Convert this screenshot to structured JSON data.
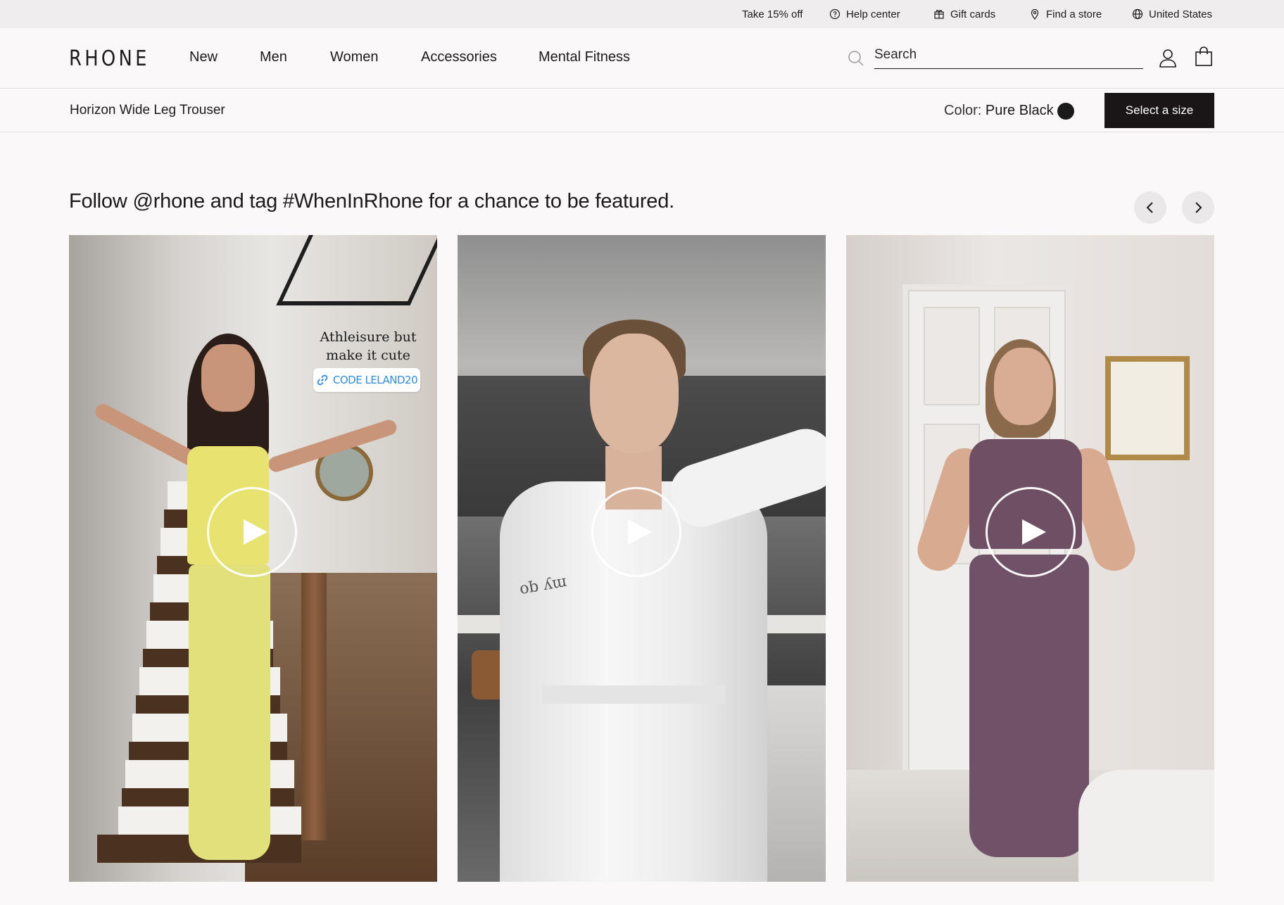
{
  "utility_bar": {
    "promo": "Take 15% off",
    "help": "Help center",
    "gift": "Gift cards",
    "store": "Find a store",
    "region": "United States"
  },
  "header": {
    "logo": "RHONE",
    "nav": [
      "New",
      "Men",
      "Women",
      "Accessories",
      "Mental Fitness"
    ],
    "search_placeholder": "Search"
  },
  "product_bar": {
    "name": "Horizon Wide Leg Trouser",
    "color_label": "Color:",
    "color_value": "Pure Black",
    "swatch_color": "#1a1a1a",
    "cta": "Select a size"
  },
  "ugc": {
    "heading": "Follow @rhone and tag #WhenInRhone for a chance to be featured.",
    "cards": [
      {
        "caption_line1": "Athleisure but",
        "caption_line2": "make it cute",
        "code": "CODE LELAND20"
      },
      {
        "embroidery": "my qo"
      },
      {}
    ]
  },
  "colors": {
    "accent_dark": "#1a1618",
    "background": "#fbf8fa",
    "utility_bg": "#efedee",
    "code_link": "#2e8de0"
  },
  "icons": [
    "help-circle-icon",
    "gift-icon",
    "map-pin-icon",
    "globe-icon",
    "search-icon",
    "user-icon",
    "shopping-bag-icon",
    "chevron-left-icon",
    "chevron-right-icon",
    "play-icon",
    "link-icon"
  ]
}
